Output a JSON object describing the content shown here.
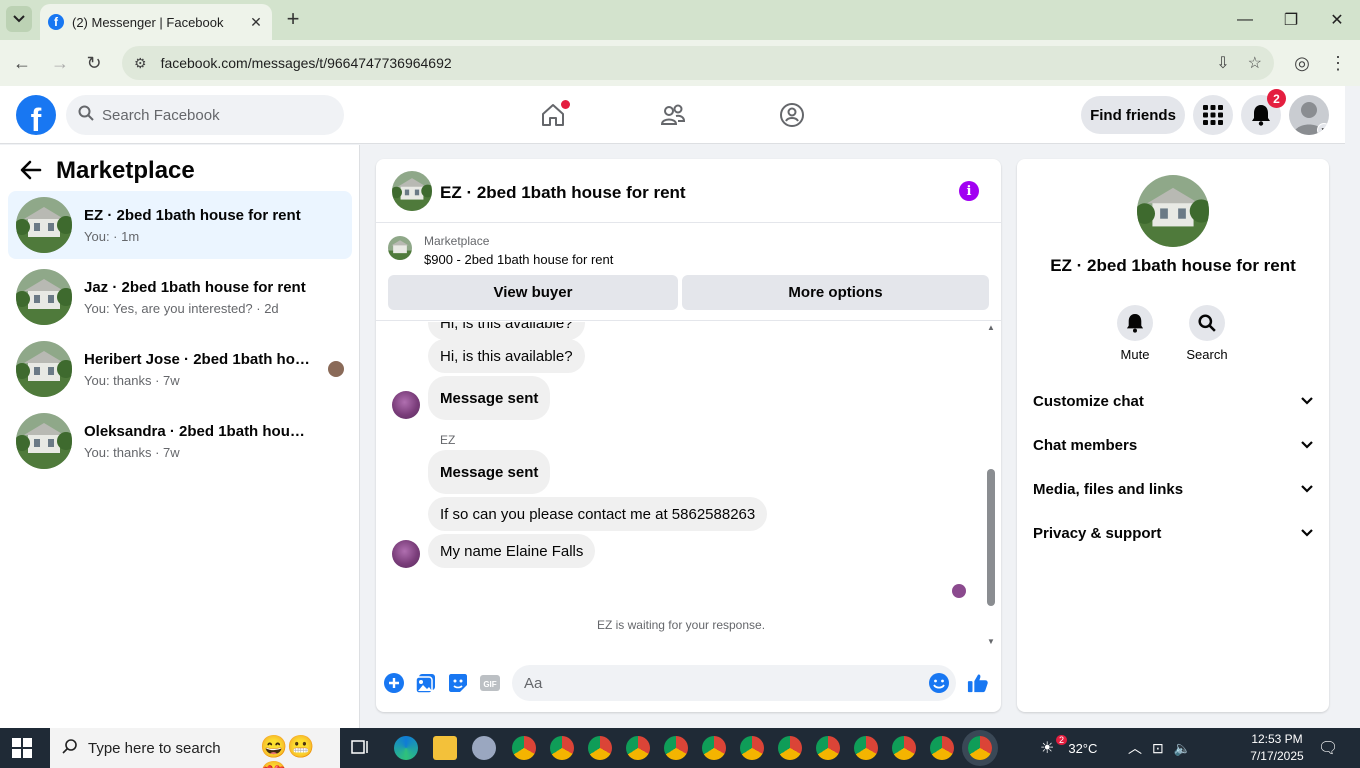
{
  "browser": {
    "tab_title": "(2) Messenger | Facebook",
    "url": "facebook.com/messages/t/9664747736964692"
  },
  "fb": {
    "search_placeholder": "Search Facebook",
    "find_friends": "Find friends",
    "notif_count": "2"
  },
  "sidebar": {
    "title": "Marketplace",
    "conversations": [
      {
        "name": "EZ · 2bed 1bath house for rent",
        "sub": "You: · 1m"
      },
      {
        "name": "Jaz · 2bed 1bath house for rent",
        "sub": "You: Yes, are you interested? · 2d"
      },
      {
        "name": "Heribert Jose · 2bed 1bath hous...",
        "sub": "You: thanks · 7w"
      },
      {
        "name": "Oleksandra · 2bed 1bath house for...",
        "sub": "You: thanks · 7w"
      }
    ]
  },
  "chat": {
    "title": "EZ · 2bed 1bath house for rent",
    "listing_source": "Marketplace",
    "listing_title": "$900 - 2bed 1bath house for rent",
    "view_buyer": "View buyer",
    "more_options": "More options",
    "messages": [
      {
        "text": "Hi, is this available?"
      },
      {
        "text": "Hi, is this available?"
      },
      {
        "text": "Message sent"
      },
      {
        "sender": "EZ"
      },
      {
        "text": "Message sent"
      },
      {
        "text": "If so can you please contact me at 5862588263"
      },
      {
        "text": "My name Elaine Falls"
      }
    ],
    "waiting": "EZ is waiting for your response.",
    "composer_placeholder": "Aa"
  },
  "right": {
    "title": "EZ · 2bed 1bath house for rent",
    "mute": "Mute",
    "search": "Search",
    "sections": [
      "Customize chat",
      "Chat members",
      "Media, files and links",
      "Privacy & support"
    ]
  },
  "taskbar": {
    "search_text": "Type here to search",
    "weather": "32°C",
    "time": "12:53 PM",
    "date": "7/17/2025",
    "weather_badge": "2"
  },
  "colors": {
    "fb_blue": "#1877f2",
    "active_row": "#ebf5ff",
    "info_purple": "#a100f2",
    "badge_red": "#e41e3f"
  }
}
